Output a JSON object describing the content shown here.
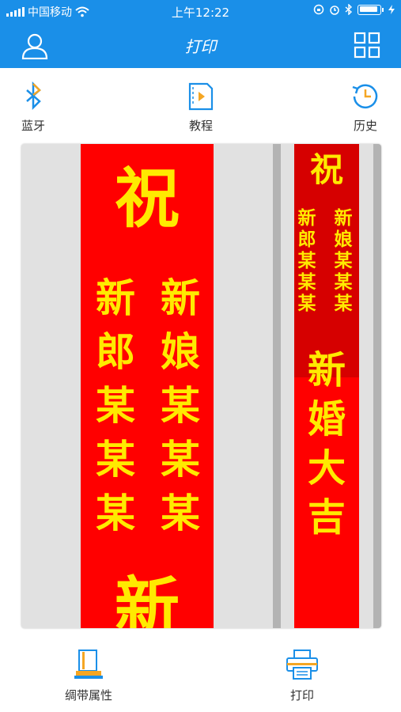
{
  "status": {
    "carrier": "中国移动",
    "time": "上午12:22"
  },
  "nav": {
    "title": "打印",
    "left_icon": "user-icon",
    "right_icon": "grid-icon"
  },
  "toolbar": {
    "bluetooth": "蓝牙",
    "tutorial": "教程",
    "history": "历史"
  },
  "preview": {
    "ribbon_a": {
      "big": "祝",
      "left_col": [
        "新",
        "郎",
        "某",
        "某",
        "某"
      ],
      "right_col": [
        "新",
        "娘",
        "某",
        "某",
        "某"
      ],
      "bottom": "新"
    },
    "ribbon_b": {
      "big": "祝",
      "left_col": [
        "新",
        "郎",
        "某",
        "某",
        "某"
      ],
      "right_col": [
        "新",
        "娘",
        "某",
        "某",
        "某"
      ],
      "phrase": [
        "新",
        "婚",
        "大",
        "吉"
      ]
    }
  },
  "bottom": {
    "ribbon_props": "绸带属性",
    "print": "打印"
  },
  "colors": {
    "accent": "#1a8fe8",
    "ribbon": "#ff0000",
    "text_gold": "#ffea00"
  }
}
